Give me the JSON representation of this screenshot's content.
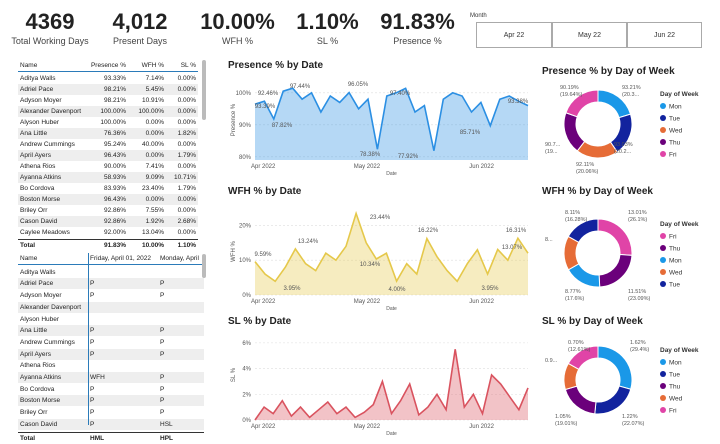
{
  "kpis": [
    {
      "value": "4369",
      "label": "Total Working Days"
    },
    {
      "value": "4,012",
      "label": "Present Days"
    },
    {
      "value": "10.00%",
      "label": "WFH %"
    },
    {
      "value": "1.10%",
      "label": "SL %"
    },
    {
      "value": "91.83%",
      "label": "Presence %"
    }
  ],
  "slicer": {
    "title": "Month",
    "options": [
      "Apr 22",
      "May 22",
      "Jun 22"
    ]
  },
  "table1": {
    "headers": [
      "Name",
      "Presence %",
      "WFH %",
      "SL %"
    ],
    "rows": [
      [
        "Aditya Walls",
        "93.33%",
        "7.14%",
        "0.00%"
      ],
      [
        "Adriel Pace",
        "98.21%",
        "5.45%",
        "0.00%"
      ],
      [
        "Adyson Moyer",
        "98.21%",
        "10.91%",
        "0.00%"
      ],
      [
        "Alexander Davenport",
        "100.00%",
        "100.00%",
        "0.00%"
      ],
      [
        "Alyson Huber",
        "100.00%",
        "0.00%",
        "0.00%"
      ],
      [
        "Ana Little",
        "76.36%",
        "0.00%",
        "1.82%"
      ],
      [
        "Andrew Cummings",
        "95.24%",
        "40.00%",
        "0.00%"
      ],
      [
        "April Ayers",
        "96.43%",
        "0.00%",
        "1.79%"
      ],
      [
        "Athena Rios",
        "90.00%",
        "7.41%",
        "0.00%"
      ],
      [
        "Ayanna Atkins",
        "58.93%",
        "9.09%",
        "10.71%"
      ],
      [
        "Bo Cordova",
        "83.93%",
        "23.40%",
        "1.79%"
      ],
      [
        "Boston Morse",
        "96.43%",
        "0.00%",
        "0.00%"
      ],
      [
        "Briley Orr",
        "92.86%",
        "7.55%",
        "0.00%"
      ],
      [
        "Cason David",
        "92.86%",
        "1.92%",
        "2.68%"
      ],
      [
        "Caylee Meadows",
        "92.00%",
        "13.04%",
        "0.00%"
      ]
    ],
    "total": [
      "Total",
      "91.83%",
      "10.00%",
      "1.10%"
    ]
  },
  "table2": {
    "headers": [
      "Name",
      "Friday, April 01, 2022",
      "Monday, April"
    ],
    "rows": [
      [
        "Aditya Walls",
        "",
        ""
      ],
      [
        "Adriel Pace",
        "P",
        "P"
      ],
      [
        "Adyson Moyer",
        "P",
        "P"
      ],
      [
        "Alexander Davenport",
        "",
        ""
      ],
      [
        "Alyson Huber",
        "",
        ""
      ],
      [
        "Ana Little",
        "P",
        "P"
      ],
      [
        "Andrew Cummings",
        "P",
        "P"
      ],
      [
        "April Ayers",
        "P",
        "P"
      ],
      [
        "Athena Rios",
        "",
        ""
      ],
      [
        "Ayanna Atkins",
        "WFH",
        "P"
      ],
      [
        "Bo Cordova",
        "P",
        "P"
      ],
      [
        "Boston Morse",
        "P",
        "P"
      ],
      [
        "Briley Orr",
        "P",
        "P"
      ],
      [
        "Cason David",
        "P",
        "HSL"
      ]
    ],
    "total": [
      "Total",
      "HML",
      "HPL"
    ]
  },
  "presence_line": {
    "title": "Presence % by Date",
    "ylabel": "Presence %",
    "xlabel": "Date",
    "yticks": [
      "100%",
      "90%",
      "80%"
    ],
    "xticks": [
      "Apr 2022",
      "May 2022",
      "Jun 2022"
    ],
    "labels": [
      "92.46%",
      "93.39%",
      "87.82%",
      "97.44%",
      "96.05%",
      "78.38%",
      "97.40%",
      "77.92%",
      "85.71%",
      "93.38%"
    ],
    "color": "#2b8fe3"
  },
  "wfh_line": {
    "title": "WFH % by Date",
    "ylabel": "WFH %",
    "xlabel": "Date",
    "yticks": [
      "20%",
      "10%",
      "0%"
    ],
    "xticks": [
      "Apr 2022",
      "May 2022",
      "Jun 2022"
    ],
    "labels": [
      "9.59%",
      "3.95%",
      "13.24%",
      "23.44%",
      "10.34%",
      "4.00%",
      "16.22%",
      "3.95%",
      "13.07%",
      "16.31%"
    ],
    "color": "#e5c84a"
  },
  "sl_line": {
    "title": "SL % by Date",
    "ylabel": "SL %",
    "xlabel": "Date",
    "yticks": [
      "6%",
      "4%",
      "2%",
      "0%"
    ],
    "xticks": [
      "Apr 2022",
      "May 2022",
      "Jun 2022"
    ],
    "color": "#d9535f"
  },
  "chart_data": [
    {
      "type": "line",
      "title": "Presence % by Date",
      "ylabel": "Presence %",
      "xlabel": "Date",
      "ylim": [
        75,
        100
      ],
      "series": [
        {
          "values": [
            92.46,
            93.39,
            87.82,
            96.5,
            97.44,
            94,
            96,
            90,
            95,
            93,
            96.05,
            91,
            94,
            78.38,
            95,
            96,
            97.4,
            90,
            92,
            77.92,
            94,
            96,
            95,
            90,
            93,
            85.71,
            94,
            95,
            93.38,
            92
          ]
        }
      ]
    },
    {
      "type": "line",
      "title": "WFH % by Date",
      "ylabel": "WFH %",
      "xlabel": "Date",
      "ylim": [
        0,
        25
      ],
      "series": [
        {
          "values": [
            9.59,
            6,
            3.95,
            8,
            13.24,
            9,
            7,
            12,
            10,
            14,
            23.44,
            15,
            10.34,
            12,
            4,
            9,
            6,
            16.22,
            11,
            7,
            3.95,
            9,
            13,
            6,
            13.07,
            10,
            16.31,
            12
          ]
        }
      ]
    },
    {
      "type": "line",
      "title": "SL % by Date",
      "ylabel": "SL %",
      "xlabel": "Date",
      "ylim": [
        0,
        7
      ],
      "series": [
        {
          "values": [
            0,
            1,
            0.5,
            1.5,
            0.3,
            1,
            0.2,
            0.8,
            1.4,
            0.5,
            1,
            0.2,
            0.6,
            1.2,
            3,
            0.5,
            1.5,
            2.8,
            0.4,
            1,
            2,
            0.8,
            5.5,
            1,
            2,
            0.5,
            3.5,
            2.8,
            1.8,
            0.8,
            2.5
          ]
        }
      ]
    },
    {
      "type": "pie",
      "title": "Presence % by Day of Week",
      "legend_title": "Day of Week",
      "categories": [
        "Mon",
        "Tue",
        "Wed",
        "Thu",
        "Fri"
      ],
      "values": [
        20.3,
        20.09,
        20.06,
        19.92,
        19.64
      ],
      "labels": [
        "93.21% (20.3...)",
        "93.03% (20.2...)",
        "92.11% (20.06%)",
        "90.7... (19...)",
        "90.19% (19.64%)"
      ]
    },
    {
      "type": "pie",
      "title": "WFH % by Day of Week",
      "legend_title": "Day of Week",
      "categories": [
        "Fri",
        "Thu",
        "Mon",
        "Wed",
        "Tue"
      ],
      "values": [
        26.1,
        23.1,
        17.6,
        16.3,
        16.9
      ],
      "labels": [
        "13.01% (26.1%)",
        "11.51% (23.09%)",
        "8.77% (17.6%)",
        "8.11% (16.28%)",
        "8..."
      ]
    },
    {
      "type": "pie",
      "title": "SL % by Day of Week",
      "legend_title": "Day of Week",
      "categories": [
        "Mon",
        "Tue",
        "Thu",
        "Wed",
        "Fri"
      ],
      "values": [
        29.4,
        22.1,
        19.0,
        12.6,
        16.9
      ],
      "labels": [
        "1.62% (29.4%)",
        "1.22% (22.07%)",
        "1.05% (19.01%)",
        "0.70% (12.61%)",
        "0.9..."
      ]
    }
  ],
  "donut_presence": {
    "title": "Presence % by Day of Week",
    "legend_title": "Day of Week",
    "legend": [
      {
        "name": "Mon",
        "color": "#1a98e8"
      },
      {
        "name": "Tue",
        "color": "#12239e"
      },
      {
        "name": "Wed",
        "color": "#e66c37"
      },
      {
        "name": "Thu",
        "color": "#6b007b"
      },
      {
        "name": "Fri",
        "color": "#e044a7"
      }
    ],
    "labels": [
      "93.21%",
      "(20.3...",
      "93.03%",
      "(20.2...",
      "92.11%",
      "(20.06%)",
      "90.7...",
      "(19...",
      "90.19%",
      "(19.64%)"
    ]
  },
  "donut_wfh": {
    "title": "WFH % by Day of Week",
    "legend_title": "Day of Week",
    "legend": [
      {
        "name": "Fri",
        "color": "#e044a7"
      },
      {
        "name": "Thu",
        "color": "#6b007b"
      },
      {
        "name": "Mon",
        "color": "#1a98e8"
      },
      {
        "name": "Wed",
        "color": "#e66c37"
      },
      {
        "name": "Tue",
        "color": "#12239e"
      }
    ],
    "labels": [
      "13.01%",
      "(26.1%)",
      "11.51%",
      "(23.09%)",
      "8.77%",
      "(17.6%)",
      "8.11%",
      "(16.28%)",
      "8..."
    ]
  },
  "donut_sl": {
    "title": "SL % by Day of Week",
    "legend_title": "Day of Week",
    "legend": [
      {
        "name": "Mon",
        "color": "#1a98e8"
      },
      {
        "name": "Tue",
        "color": "#12239e"
      },
      {
        "name": "Thu",
        "color": "#6b007b"
      },
      {
        "name": "Wed",
        "color": "#e66c37"
      },
      {
        "name": "Fri",
        "color": "#e044a7"
      }
    ],
    "labels": [
      "1.62%",
      "(29.4%)",
      "1.22%",
      "(22.07%)",
      "1.05%",
      "(19.01%)",
      "0.70%",
      "(12.61%)",
      "0.9..."
    ]
  }
}
